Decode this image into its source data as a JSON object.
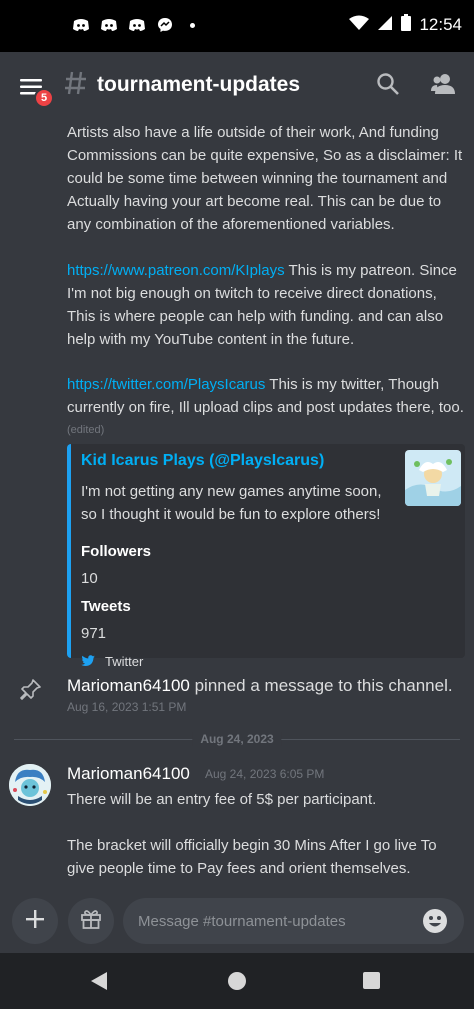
{
  "status_bar": {
    "time": "12:54",
    "notification_icons": [
      "discord-icon",
      "discord-icon",
      "discord-icon",
      "messenger-icon"
    ]
  },
  "header": {
    "channel_name": "tournament-updates",
    "notification_count": "5"
  },
  "messages": {
    "block1": "Artists also have a life outside of their work, And funding Commissions can be quite expensive, So as a disclaimer: It could be some time between winning the tournament and Actually having your art become real. This can be due to any combination of the aforementioned variables.",
    "patreon_link": "https://www.patreon.com/KIplays",
    "patreon_text": " This is my patreon. Since I'm not big enough on twitch to receive direct donations, This is where people can help with funding. and can also help with my YouTube content in the future.",
    "twitter_link": "https://twitter.com/PlaysIcarus",
    "twitter_text": " This is my twitter, Though currently on fire, Ill upload clips and post updates there, too.",
    "edited": "(edited)"
  },
  "embed": {
    "author": "Kid Icarus Plays (@PlaysIcarus)",
    "description": "I'm not getting any new games anytime soon, so I thought it would be fun to explore others!",
    "fields": [
      {
        "name": "Followers",
        "value": "10"
      },
      {
        "name": "Tweets",
        "value": "971"
      }
    ],
    "footer": "Twitter",
    "accent_color": "#1da1f2"
  },
  "pin_notice": {
    "user": "Marioman64100",
    "text": " pinned a message to this channel.",
    "timestamp": "Aug 16, 2023 1:51 PM"
  },
  "date_divider": "Aug 24, 2023",
  "message2": {
    "username": "Marioman64100",
    "timestamp": "Aug 24, 2023 6:05 PM",
    "line1": "There will be an entry fee of 5$ per participant.",
    "line2": "The bracket will officially begin 30 Mins After I go live To give people time to Pay fees and orient themselves."
  },
  "composer": {
    "placeholder": "Message #tournament-updates"
  },
  "colors": {
    "background": "#36393f",
    "link": "#00aff4",
    "badge": "#ed4245"
  }
}
